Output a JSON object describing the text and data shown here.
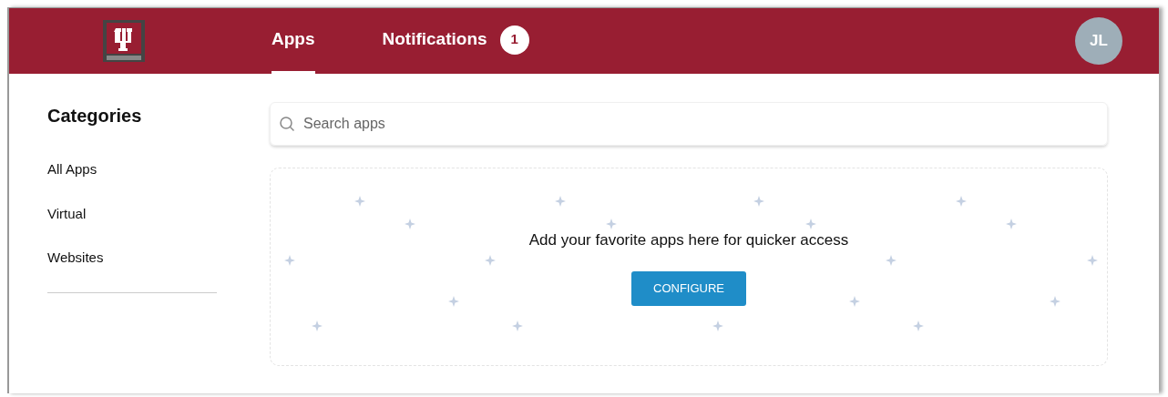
{
  "header": {
    "tabs": [
      {
        "label": "Apps",
        "selected": true
      },
      {
        "label": "Notifications",
        "selected": false,
        "badge": "1"
      }
    ],
    "avatar": "JL"
  },
  "sidebar": {
    "title": "Categories",
    "items": [
      {
        "label": "All Apps"
      },
      {
        "label": "Virtual"
      },
      {
        "label": "Websites"
      }
    ]
  },
  "search": {
    "placeholder": "Search apps"
  },
  "favorites": {
    "message": "Add your favorite apps here for quicker access",
    "button": "CONFIGURE"
  }
}
